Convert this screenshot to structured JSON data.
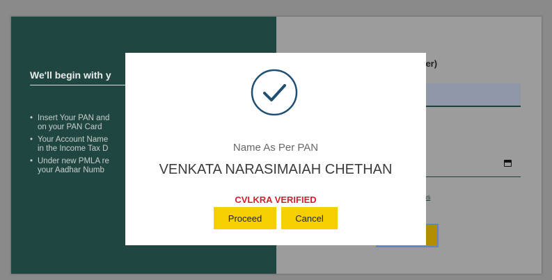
{
  "page": {
    "left_heading": "We'll begin with y",
    "bullets": [
      "Insert Your PAN and\non your PAN Card",
      "Your Account Name\nin the Income Tax D",
      "Under new PMLA re\nyour Aadhar Numb"
    ],
    "right_label": "umber)",
    "terms_link": "ions"
  },
  "modal": {
    "icon": "checkmark-circle-icon",
    "name_label": "Name As Per PAN",
    "name_value": "VENKATA NARASIMAIAH CHETHAN",
    "status": "CVLKRA VERIFIED",
    "proceed_label": "Proceed",
    "cancel_label": "Cancel"
  },
  "colors": {
    "accent": "#f6cf00",
    "status": "#d31f2b",
    "panel": "#1f4640",
    "check": "#1f4f72"
  }
}
